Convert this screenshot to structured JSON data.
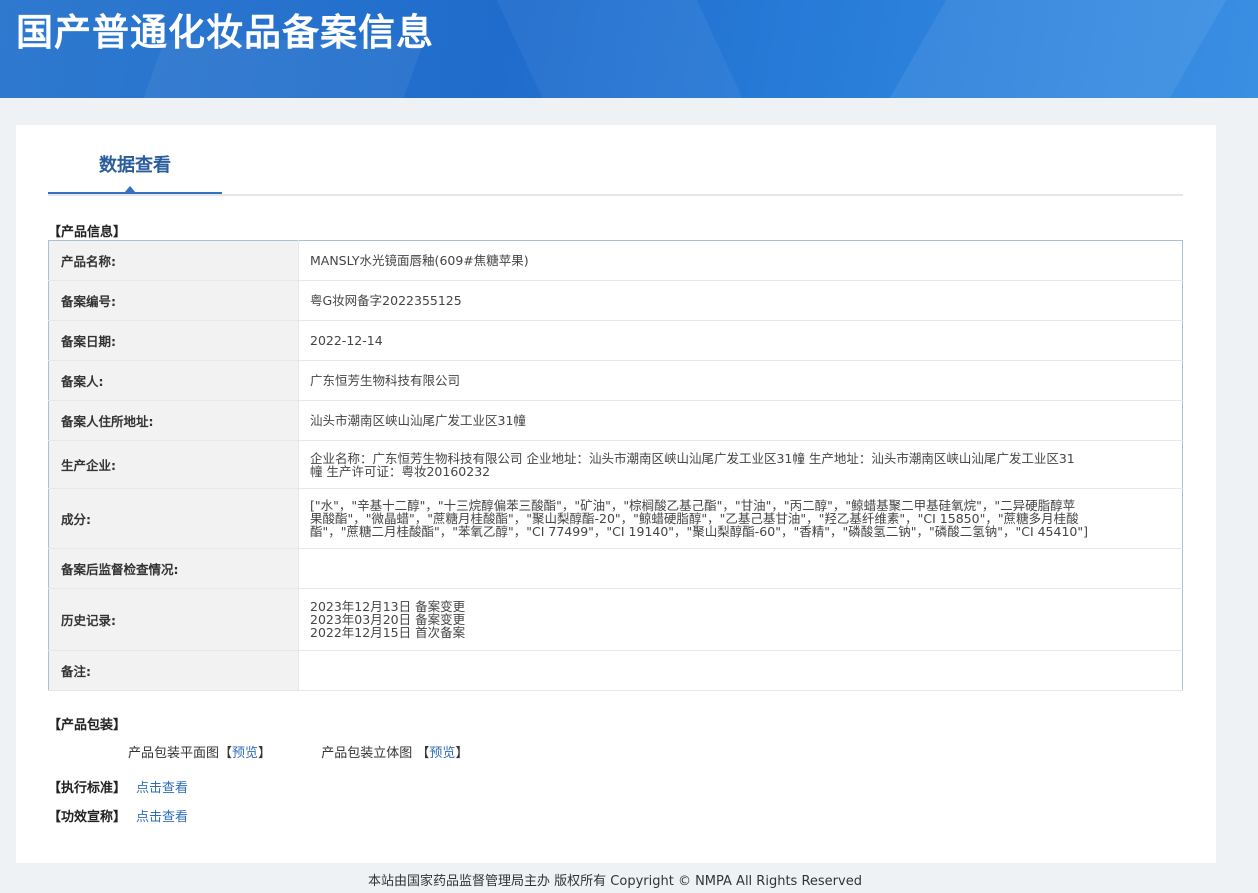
{
  "header": {
    "title": "国产普通化妆品备案信息"
  },
  "tabs": [
    {
      "label": "数据查看"
    }
  ],
  "product_info": {
    "title": "【产品信息】",
    "rows": [
      {
        "label": "产品名称:",
        "value": [
          "MANSLY水光镜面唇釉(609#焦糖苹果)"
        ]
      },
      {
        "label": "备案编号:",
        "value": [
          "粤G妆网备字2022355125"
        ]
      },
      {
        "label": "备案日期:",
        "value": [
          "2022-12-14"
        ]
      },
      {
        "label": "备案人:",
        "value": [
          "广东恒芳生物科技有限公司"
        ]
      },
      {
        "label": "备案人住所地址:",
        "value": [
          "汕头市潮南区峡山汕尾广发工业区31幢"
        ]
      },
      {
        "label": "生产企业:",
        "value": [
          "企业名称：广东恒芳生物科技有限公司 企业地址：汕头市潮南区峡山汕尾广发工业区31幢 生产地址：汕头市潮南区峡山汕尾广发工业区31",
          "幢 生产许可证：粤妆20160232"
        ]
      },
      {
        "label": "成分:",
        "value": [
          "[\"水\"，\"辛基十二醇\"，\"十三烷醇偏苯三酸酯\"，\"矿油\"，\"棕榈酸乙基己酯\"，\"甘油\"，\"丙二醇\"，\"鲸蜡基聚二甲基硅氧烷\"，\"二异硬脂醇苹",
          "果酸酯\"，\"微晶蜡\"，\"蔗糖月桂酸酯\"，\"聚山梨醇酯-20\"，\"鲸蜡硬脂醇\"，\"乙基己基甘油\"，\"羟乙基纤维素\"，\"CI 15850\"，\"蔗糖多月桂酸",
          "酯\"，\"蔗糖二月桂酸酯\"，\"苯氧乙醇\"，\"CI 77499\"，\"CI 19140\"，\"聚山梨醇酯-60\"，\"香精\"，\"磷酸氢二钠\"，\"磷酸二氢钠\"，\"CI 45410\"]"
        ]
      },
      {
        "label": "备案后监督检查情况:",
        "value": []
      },
      {
        "label": "历史记录:",
        "value": [
          "2023年12月13日 备案变更",
          "2023年03月20日 备案变更",
          "2022年12月15日 首次备案"
        ]
      },
      {
        "label": "备注:",
        "value": []
      }
    ]
  },
  "packaging": {
    "title": "【产品包装】",
    "flat": {
      "label": "产品包装平面图",
      "open": "【",
      "link": "预览",
      "close": "】"
    },
    "solid": {
      "label": "产品包装立体图",
      "open": " 【",
      "link": "预览",
      "close": "】"
    }
  },
  "standard": {
    "title": "【执行标准】",
    "link": "点击查看"
  },
  "efficacy": {
    "title": "【功效宣称】",
    "link": "点击查看"
  },
  "footer": {
    "text": "本站由国家药品监督管理局主办 版权所有 Copyright © NMPA All Rights Reserved"
  },
  "colors": {
    "banner": "#1f6ccc",
    "tab_accent": "#3470c2",
    "link": "#2f6db8"
  }
}
